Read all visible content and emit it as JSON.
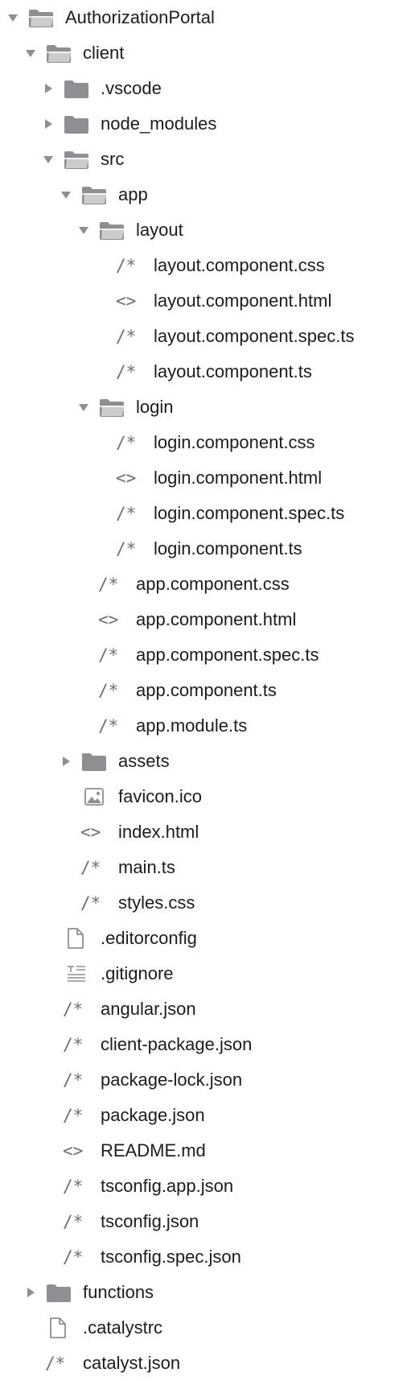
{
  "tree": [
    {
      "label": "AuthorizationPortal",
      "level": 0,
      "kind": "folder-open",
      "disclosure": "expanded"
    },
    {
      "label": "client",
      "level": 1,
      "kind": "folder-open",
      "disclosure": "expanded"
    },
    {
      "label": ".vscode",
      "level": 2,
      "kind": "folder",
      "disclosure": "collapsed"
    },
    {
      "label": "node_modules",
      "level": 2,
      "kind": "folder",
      "disclosure": "collapsed"
    },
    {
      "label": "src",
      "level": 2,
      "kind": "folder-open",
      "disclosure": "expanded"
    },
    {
      "label": "app",
      "level": 3,
      "kind": "folder-open",
      "disclosure": "expanded"
    },
    {
      "label": "layout",
      "level": 4,
      "kind": "folder-open",
      "disclosure": "expanded"
    },
    {
      "label": "layout.component.css",
      "level": 5,
      "kind": "comment",
      "disclosure": "none"
    },
    {
      "label": "layout.component.html",
      "level": 5,
      "kind": "code",
      "disclosure": "none"
    },
    {
      "label": "layout.component.spec.ts",
      "level": 5,
      "kind": "comment",
      "disclosure": "none"
    },
    {
      "label": "layout.component.ts",
      "level": 5,
      "kind": "comment",
      "disclosure": "none"
    },
    {
      "label": "login",
      "level": 4,
      "kind": "folder-open",
      "disclosure": "expanded"
    },
    {
      "label": "login.component.css",
      "level": 5,
      "kind": "comment",
      "disclosure": "none"
    },
    {
      "label": "login.component.html",
      "level": 5,
      "kind": "code",
      "disclosure": "none"
    },
    {
      "label": "login.component.spec.ts",
      "level": 5,
      "kind": "comment",
      "disclosure": "none"
    },
    {
      "label": "login.component.ts",
      "level": 5,
      "kind": "comment",
      "disclosure": "none"
    },
    {
      "label": "app.component.css",
      "level": 4,
      "kind": "comment",
      "disclosure": "none"
    },
    {
      "label": "app.component.html",
      "level": 4,
      "kind": "code",
      "disclosure": "none"
    },
    {
      "label": "app.component.spec.ts",
      "level": 4,
      "kind": "comment",
      "disclosure": "none"
    },
    {
      "label": "app.component.ts",
      "level": 4,
      "kind": "comment",
      "disclosure": "none"
    },
    {
      "label": "app.module.ts",
      "level": 4,
      "kind": "comment",
      "disclosure": "none"
    },
    {
      "label": "assets",
      "level": 3,
      "kind": "folder",
      "disclosure": "collapsed"
    },
    {
      "label": "favicon.ico",
      "level": 3,
      "kind": "image",
      "disclosure": "none"
    },
    {
      "label": "index.html",
      "level": 3,
      "kind": "code",
      "disclosure": "none"
    },
    {
      "label": "main.ts",
      "level": 3,
      "kind": "comment",
      "disclosure": "none"
    },
    {
      "label": "styles.css",
      "level": 3,
      "kind": "comment",
      "disclosure": "none"
    },
    {
      "label": ".editorconfig",
      "level": 2,
      "kind": "file",
      "disclosure": "none"
    },
    {
      "label": ".gitignore",
      "level": 2,
      "kind": "text",
      "disclosure": "none"
    },
    {
      "label": "angular.json",
      "level": 2,
      "kind": "comment",
      "disclosure": "none"
    },
    {
      "label": "client-package.json",
      "level": 2,
      "kind": "comment",
      "disclosure": "none"
    },
    {
      "label": "package-lock.json",
      "level": 2,
      "kind": "comment",
      "disclosure": "none"
    },
    {
      "label": "package.json",
      "level": 2,
      "kind": "comment",
      "disclosure": "none"
    },
    {
      "label": "README.md",
      "level": 2,
      "kind": "code",
      "disclosure": "none"
    },
    {
      "label": "tsconfig.app.json",
      "level": 2,
      "kind": "comment",
      "disclosure": "none"
    },
    {
      "label": "tsconfig.json",
      "level": 2,
      "kind": "comment",
      "disclosure": "none"
    },
    {
      "label": "tsconfig.spec.json",
      "level": 2,
      "kind": "comment",
      "disclosure": "none"
    },
    {
      "label": "functions",
      "level": 1,
      "kind": "folder",
      "disclosure": "collapsed"
    },
    {
      "label": ".catalystrc",
      "level": 1,
      "kind": "file",
      "disclosure": "none"
    },
    {
      "label": "catalyst.json",
      "level": 1,
      "kind": "comment",
      "disclosure": "none"
    }
  ],
  "colors": {
    "text": "#1c1c1e",
    "icon": "#8e8e93",
    "glyph": "#6e6e73"
  }
}
